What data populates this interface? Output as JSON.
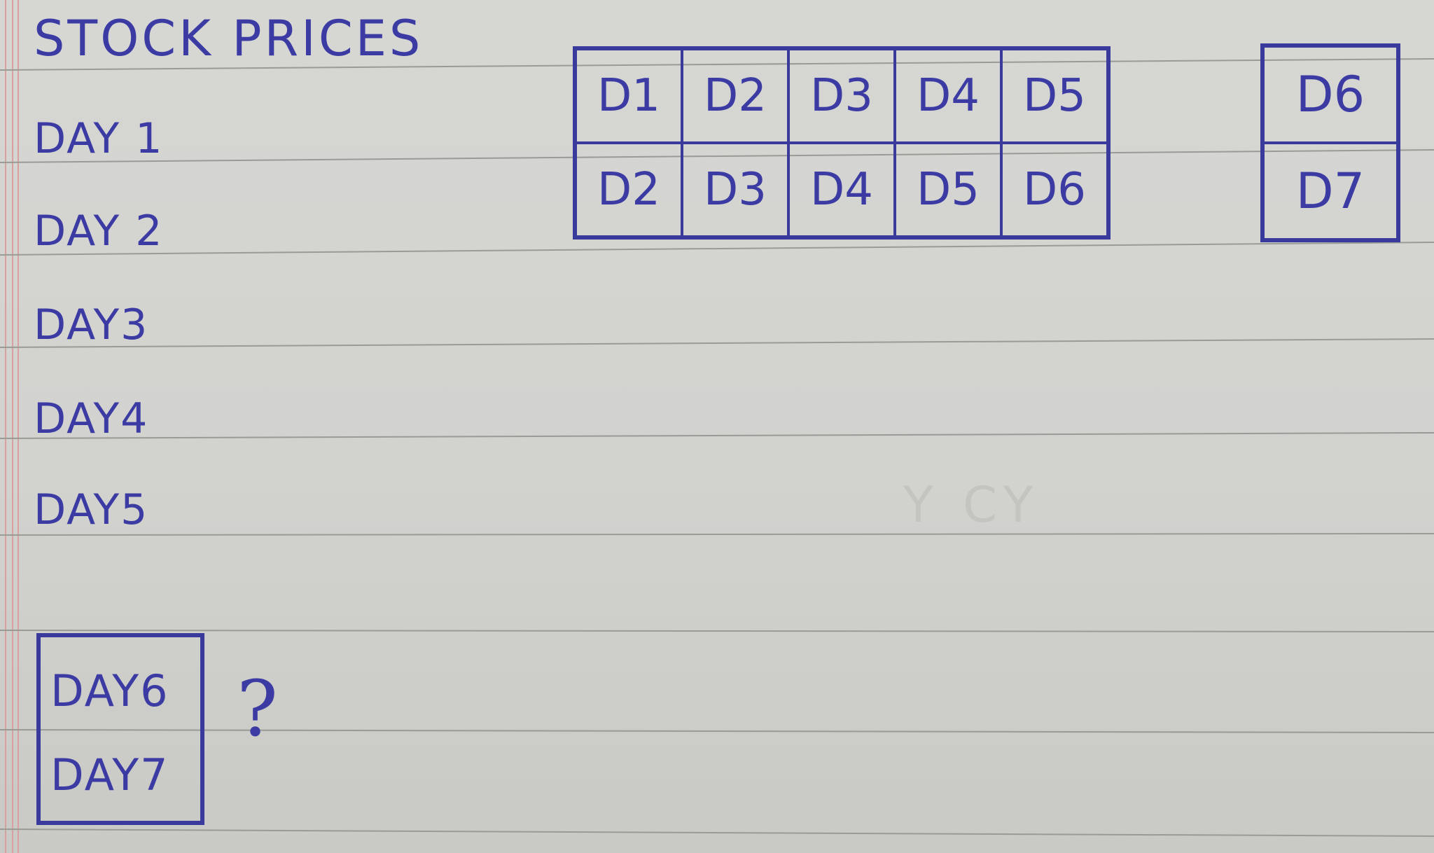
{
  "title": "STOCK PRICES",
  "day_labels": [
    "DAY 1",
    "DAY 2",
    "DAY3",
    "DAY4",
    "DAY5"
  ],
  "main_table": {
    "rows": [
      [
        "D1",
        "D2",
        "D3",
        "D4",
        "D5"
      ],
      [
        "D2",
        "D3",
        "D4",
        "D5",
        "D6"
      ]
    ]
  },
  "side_table": {
    "rows": [
      [
        "D6"
      ],
      [
        "D7"
      ]
    ]
  },
  "question_box": {
    "lines": [
      "DAY6",
      "DAY7"
    ],
    "mark": "?"
  },
  "ink_color": "#3b3ba3",
  "paper_color": "#d4d4d1"
}
